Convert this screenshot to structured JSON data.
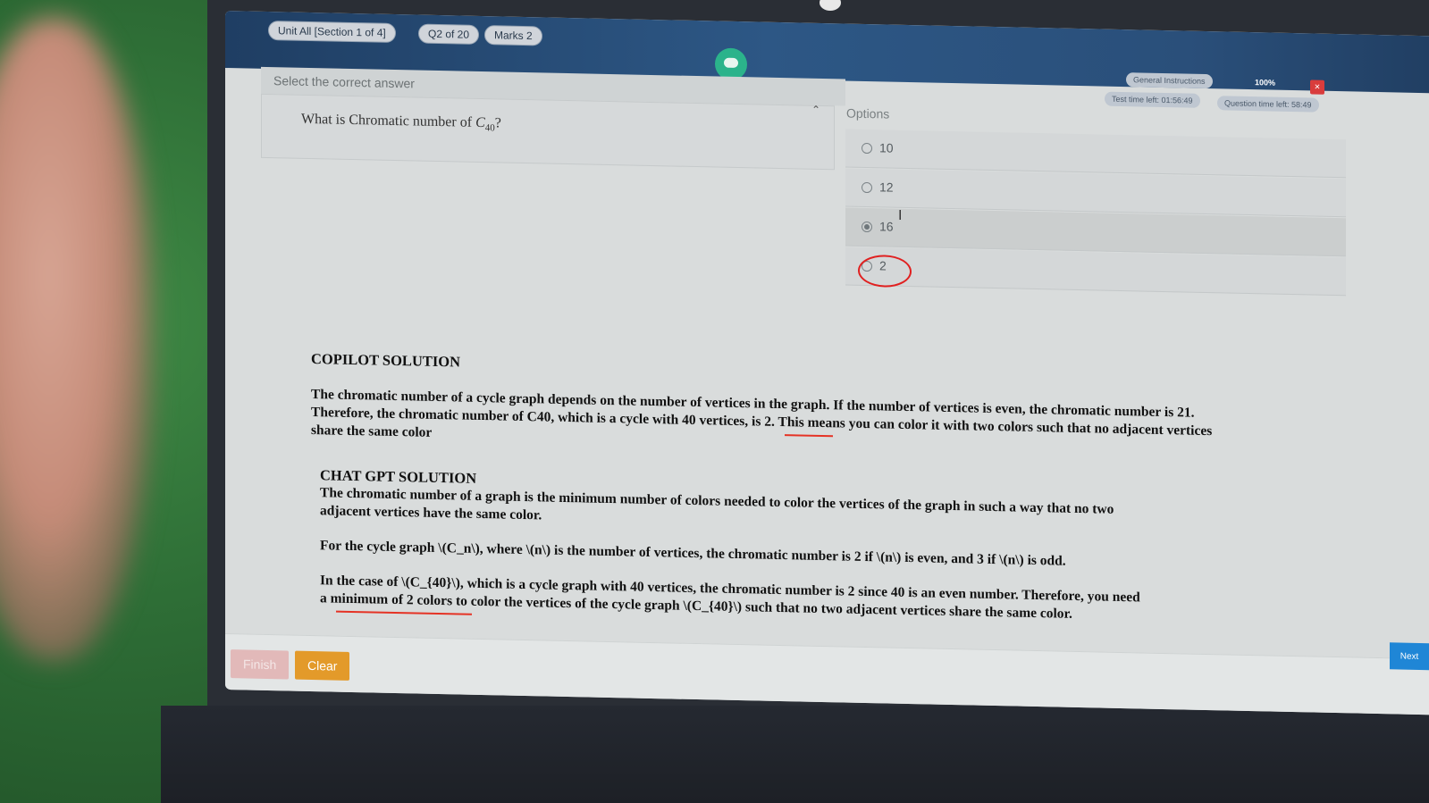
{
  "header": {
    "section_pill": "Unit All [Section 1 of 4]",
    "question_pill": "Q2 of 20",
    "marks_pill": "Marks 2",
    "general_instructions": "General Instructions",
    "zoom": "100%",
    "test_time_left": "Test time left: 01:56:49",
    "question_time_left": "Question time left: 58:49"
  },
  "question": {
    "instruction": "Select the correct answer",
    "text": "What is Chromatic number of",
    "subject": "C",
    "subscript": "40",
    "suffix": "?"
  },
  "options": {
    "label": "Options",
    "items": [
      {
        "text": "10",
        "selected": false
      },
      {
        "text": "12",
        "selected": false
      },
      {
        "text": "16",
        "selected": true
      },
      {
        "text": "2",
        "selected": false
      }
    ]
  },
  "copilot": {
    "heading": "COPILOT SOLUTION",
    "line1": "The chromatic number of a cycle graph depends on the number of vertices in the graph. If the number of vertices is even, the chromatic number is 21.",
    "line2": "Therefore, the chromatic number of C40, which is a cycle with 40 vertices, is 2. This means you can color it with two colors such that no adjacent vertices",
    "line3": "share the same color"
  },
  "chatgpt": {
    "heading": "CHAT GPT SOLUTION",
    "p1_line1": "The chromatic number of a graph is the minimum number of colors needed to color the vertices of the graph in such a way that no two",
    "p1_line2": "adjacent vertices have the same color.",
    "p2": "For the cycle graph \\(C_n\\), where \\(n\\) is the number of vertices, the chromatic number is 2 if \\(n\\) is even, and 3 if \\(n\\) is odd.",
    "p3_line1": "In the case of \\(C_{40}\\), which is a cycle graph with 40 vertices, the chromatic number is 2 since 40 is an even number. Therefore, you need",
    "p3_line2": "a minimum of 2 colors to color the vertices of the cycle graph \\(C_{40}\\) such that no two adjacent vertices share the same color."
  },
  "footer": {
    "finish_label": "Finish",
    "clear_label": "Clear",
    "next_label": "Next"
  },
  "colors": {
    "header_blue": "#2d5785",
    "clear_orange": "#e39a2a",
    "annotation_red": "#e02020",
    "next_blue": "#1f86d6"
  }
}
